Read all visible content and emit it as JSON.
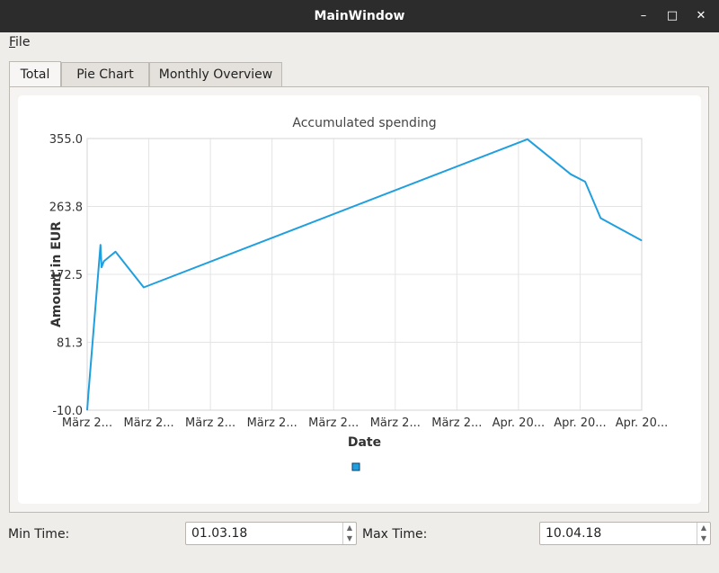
{
  "window": {
    "title": "MainWindow",
    "minimize_glyph": "–",
    "maximize_glyph": "□",
    "close_glyph": "✕"
  },
  "menubar": {
    "file_label_first": "F",
    "file_label_rest": "ile"
  },
  "tabs": [
    {
      "label": "Total",
      "active": true
    },
    {
      "label": "Pie Chart",
      "active": false
    },
    {
      "label": "Monthly Overview",
      "active": false
    }
  ],
  "chart_data": {
    "type": "line",
    "title": "Accumulated spending",
    "xlabel": "Date",
    "ylabel": "Amount in EUR",
    "yticks": [
      "-10.0",
      "81.3",
      "172.5",
      "263.8",
      "355.0"
    ],
    "xtick_labels": [
      "März 2...",
      "März 2...",
      "März 2...",
      "März 2...",
      "März 2...",
      "März 2...",
      "März 2...",
      "Apr. 20...",
      "Apr. 20...",
      "Apr. 20..."
    ],
    "ylim": [
      -10.0,
      355.0
    ],
    "xlim": [
      0,
      1
    ],
    "grid": true,
    "series": [
      {
        "color": "#209fdf",
        "x": [
          0.0,
          0.002,
          0.024,
          0.026,
          0.03,
          0.051,
          0.102,
          0.794,
          0.872,
          0.898,
          0.926,
          1.0
        ],
        "y": [
          -10,
          10,
          212,
          182,
          190,
          203,
          155,
          354,
          307,
          297,
          248,
          218
        ]
      }
    ],
    "legend": {
      "position": "bottom",
      "color": "#209fdf"
    }
  },
  "controls": {
    "min_label": "Min Time:",
    "min_value": "01.03.18",
    "max_label": "Max Time:",
    "max_value": "10.04.18",
    "up_glyph": "▲",
    "down_glyph": "▼"
  }
}
